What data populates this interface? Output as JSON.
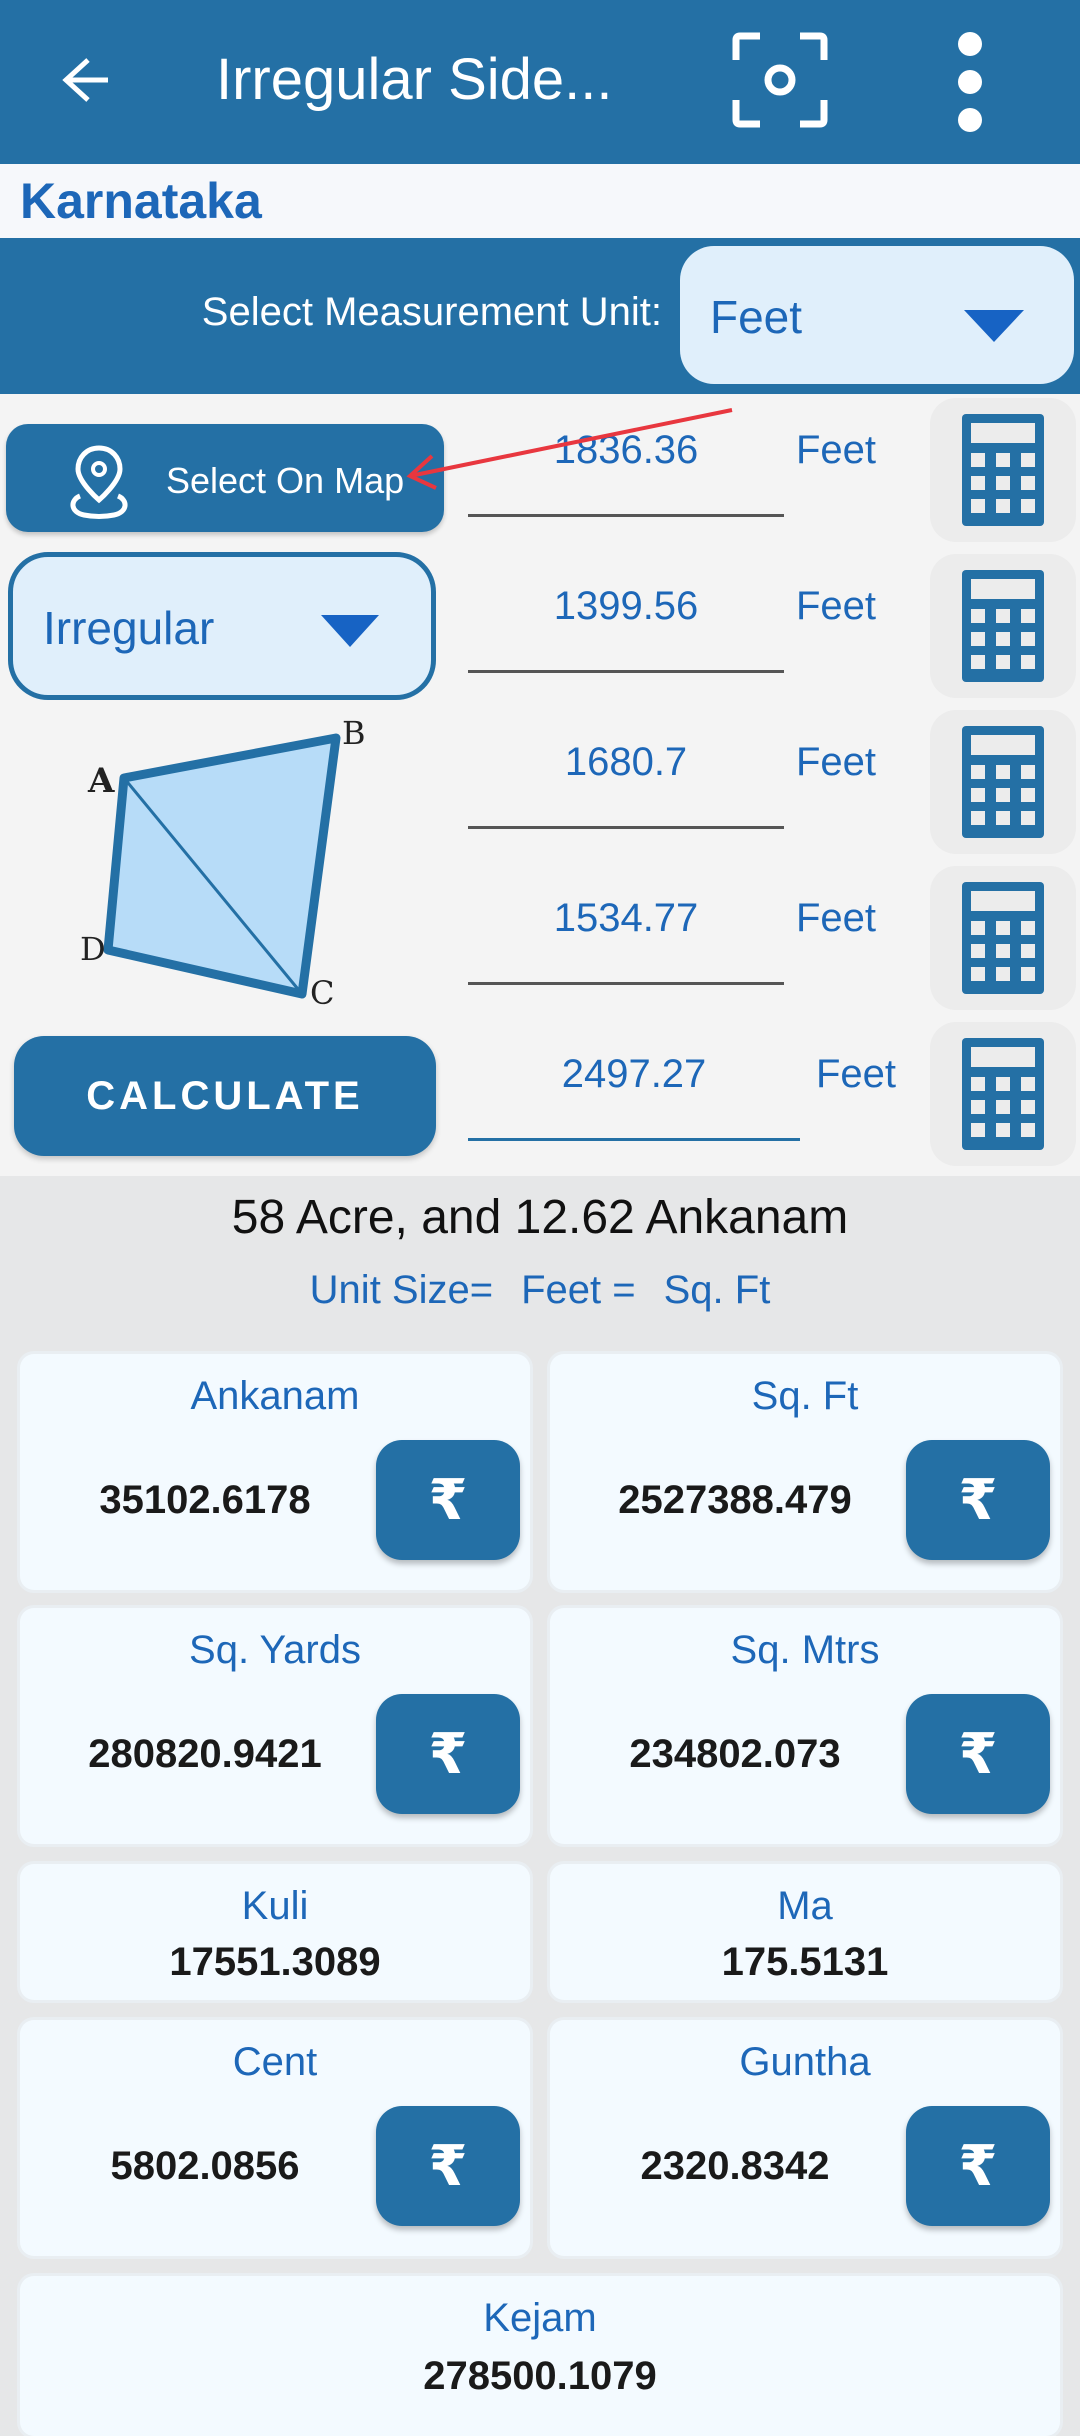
{
  "appbar": {
    "title": "Irregular Side...",
    "back_icon": "arrow-left-icon",
    "scan_icon": "screenshot-scan-icon",
    "more_icon": "more-vertical-icon"
  },
  "state": "Karnataka",
  "unit_bar": {
    "label": "Select Measurement Unit:",
    "selected": "Feet"
  },
  "inputs": {
    "map_button": "Select On Map",
    "shape_selected": "Irregular",
    "calculate_button": "CALCULATE",
    "diagram_labels": {
      "a": "A",
      "b": "B",
      "c": "C",
      "d": "D"
    },
    "sides": [
      {
        "value": "1836.36",
        "unit": "Feet"
      },
      {
        "value": "1399.56",
        "unit": "Feet"
      },
      {
        "value": "1680.7",
        "unit": "Feet"
      },
      {
        "value": "1534.77",
        "unit": "Feet"
      },
      {
        "value": "2497.27",
        "unit": "Feet"
      }
    ]
  },
  "summary": {
    "acre_text": "58 Acre,  and 12.62 Ankanam",
    "unit_size": [
      "Unit Size=",
      "Feet =",
      "Sq. Ft"
    ]
  },
  "results": [
    {
      "name": "Ankanam",
      "value": "35102.6178",
      "has_price": true
    },
    {
      "name": "Sq. Ft",
      "value": "2527388.479",
      "has_price": true
    },
    {
      "name": "Sq. Yards",
      "value": "280820.9421",
      "has_price": true
    },
    {
      "name": "Sq. Mtrs",
      "value": "234802.073",
      "has_price": true
    },
    {
      "name": "Kuli",
      "value": "17551.3089",
      "has_price": false
    },
    {
      "name": "Ma",
      "value": "175.5131",
      "has_price": false
    },
    {
      "name": "Cent",
      "value": "5802.0856",
      "has_price": true
    },
    {
      "name": "Guntha",
      "value": "2320.8342",
      "has_price": true
    },
    {
      "name": "Kejam",
      "value": "278500.1079",
      "has_price": false
    }
  ],
  "price_symbol": "₹",
  "colors": {
    "primary": "#2470a5",
    "accent_text": "#1d67b8",
    "annotation_arrow": "#e8373f"
  }
}
